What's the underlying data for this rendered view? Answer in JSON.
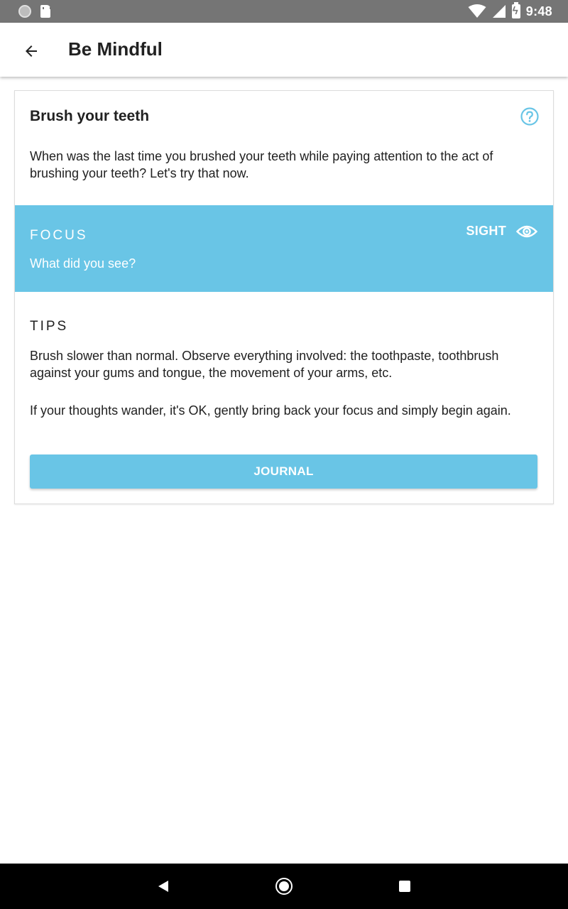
{
  "status_bar": {
    "time": "9:48",
    "icons": [
      "notification-dot-icon",
      "sd-card-icon",
      "wifi-icon",
      "cell-signal-icon",
      "battery-charging-icon"
    ]
  },
  "app_bar": {
    "title": "Be Mindful",
    "back_icon": "arrow-back-icon"
  },
  "card": {
    "title": "Brush your teeth",
    "help_icon": "help-circle-icon",
    "description": "When was the last time you brushed your teeth while paying attention to the act of brushing your teeth? Let's try that now.",
    "focus": {
      "heading": "FOCUS",
      "question": "What did you see?",
      "sense_label": "SIGHT",
      "sense_icon": "eye-icon"
    },
    "tips": {
      "heading": "TIPS",
      "paragraphs": [
        "Brush slower than normal. Observe everything involved: the toothpaste, toothbrush against your gums and tongue, the movement of your arms, etc.",
        "If your thoughts wander, it's OK, gently bring back your focus and simply begin again."
      ]
    },
    "journal_button": "JOURNAL"
  },
  "nav_bar": {
    "icons": [
      "nav-back-icon",
      "nav-home-icon",
      "nav-recents-icon"
    ]
  },
  "colors": {
    "accent": "#69c5e6",
    "status_bar": "#757575",
    "text": "#212121"
  }
}
